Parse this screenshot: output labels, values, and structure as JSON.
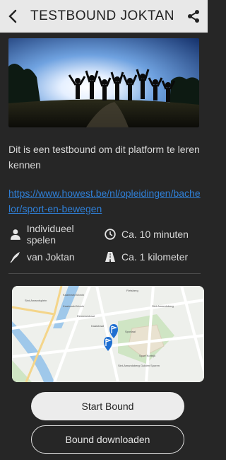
{
  "header": {
    "title": "TESTBOUND JOKTAN",
    "back_icon": "chevron-left-icon",
    "share_icon": "share-icon"
  },
  "hero_image": {
    "subject": "silhouettes-of-people-jumping-at-sunset"
  },
  "description": "Dit is een testbound om dit platform te leren kennen",
  "link": "https://www.howest.be/nl/opleidingen/bachelor/sport-en-bewegen",
  "info": {
    "mode": "Individueel spelen",
    "duration": "Ca. 10 minuten",
    "author": "van Joktan",
    "distance": "Ca. 1 kilometer"
  },
  "map": {
    "labels": [
      "Kaaimarkt Monin",
      "Kaaimarkt Monin",
      "Sint-Amandsplein",
      "Eensnarstraat",
      "Sint-Amandsberg",
      "Fietsberg",
      "Kaaistraat",
      "Sport Kortrijk",
      "Sportaal",
      "Sint-Amandsberg Gulden Sporen"
    ]
  },
  "buttons": {
    "start": "Start Bound",
    "download": "Bound downloaden"
  },
  "colors": {
    "accent_link": "#2f7fd6",
    "map_marker": "#1f6fd1",
    "background": "#262626"
  }
}
